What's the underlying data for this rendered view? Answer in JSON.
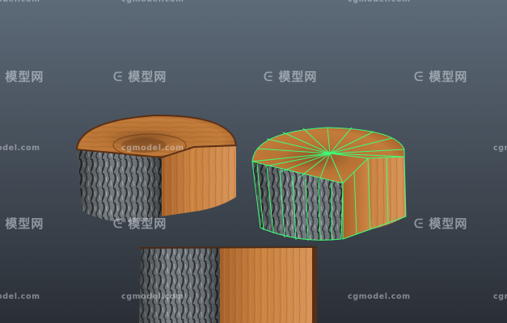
{
  "viewport": {
    "background_top": "#5d6a78",
    "background_bottom": "#2a2f36"
  },
  "watermark": {
    "logo_text": "模型网",
    "url_text": "cgmodel.com",
    "logo_icon": "cg-logo-icon"
  },
  "objects": [
    {
      "name": "stump-textured",
      "selected": false
    },
    {
      "name": "stump-wireframe",
      "selected": true,
      "wire_color": "#3dff7a"
    },
    {
      "name": "stump-side-view",
      "selected": false
    }
  ],
  "materials": {
    "bark_color": "#7f868c",
    "bark_dark": "#3a3f44",
    "wood_top": "#b06a2e",
    "wood_side": "#c07a3c",
    "wood_cut_light": "#d18a47",
    "rim_color": "#5a2e14"
  }
}
